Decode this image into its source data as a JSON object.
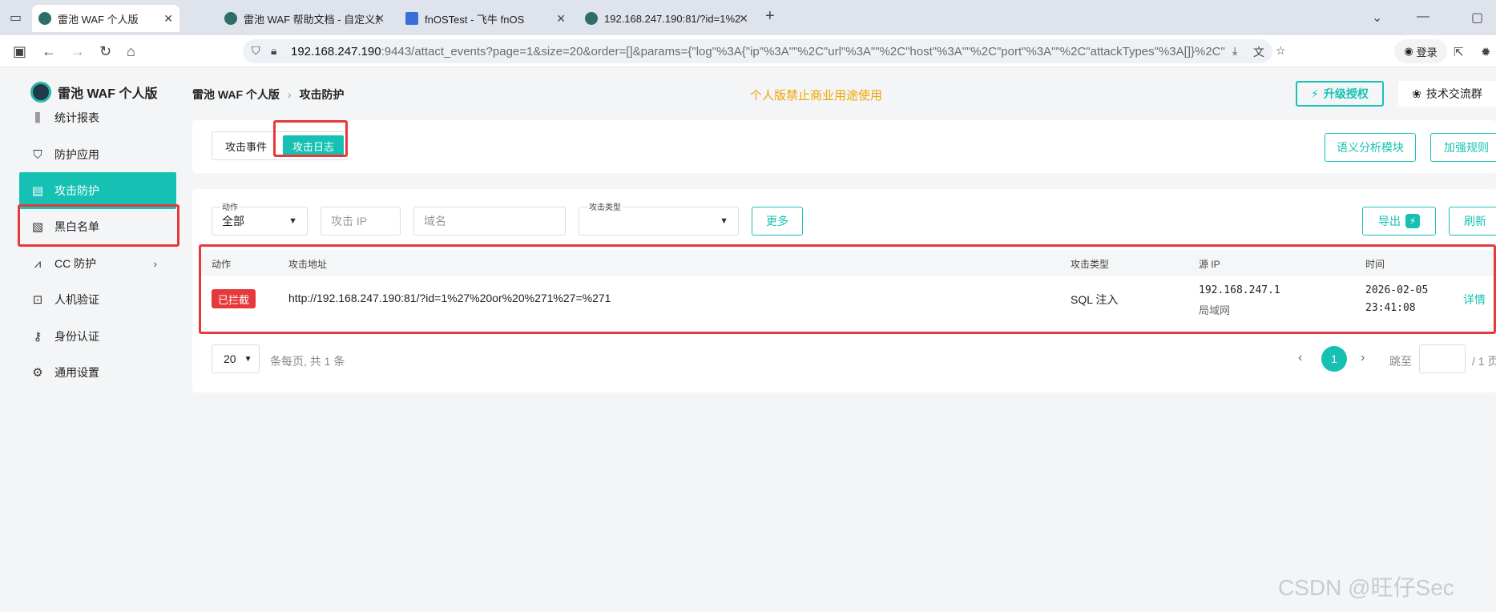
{
  "browser": {
    "tabs": [
      {
        "title": "雷池 WAF 个人版",
        "active": true
      },
      {
        "title": "雷池 WAF 帮助文档 - 自定义规",
        "active": false
      },
      {
        "title": "fnOSTest - 飞牛 fnOS",
        "active": false
      },
      {
        "title": "192.168.247.190:81/?id=1%2",
        "active": false
      }
    ],
    "url_host": "192.168.247.190",
    "url_rest": ":9443/attact_events?page=1&size=20&order=[]&params={\"log\"%3A{\"ip\"%3A\"\"%2C\"url\"%3A\"\"%2C\"host\"%3A\"\"%2C\"port\"%3A\"\"%2C\"attackTypes\"%3A[]}%2C\"",
    "login_label": "登录"
  },
  "app": {
    "name": "雷池 WAF 个人版",
    "breadcrumb": [
      "雷池 WAF 个人版",
      "攻击防护"
    ],
    "notice": "个人版禁止商业用途使用",
    "upgrade_label": "升级授权",
    "group_label": "技术交流群"
  },
  "sidebar": {
    "items": [
      {
        "label": "统计报表",
        "icon": "bar-chart-icon",
        "glyph": "⫼"
      },
      {
        "label": "防护应用",
        "icon": "shield-icon",
        "glyph": "⛉"
      },
      {
        "label": "攻击防护",
        "icon": "document-shield-icon",
        "glyph": "▤",
        "active": true
      },
      {
        "label": "黑白名单",
        "icon": "list-filter-icon",
        "glyph": "▧"
      },
      {
        "label": "CC 防护",
        "icon": "wave-icon",
        "glyph": "⩘",
        "has_children": true
      },
      {
        "label": "人机验证",
        "icon": "robot-icon",
        "glyph": "⊡"
      },
      {
        "label": "身份认证",
        "icon": "key-icon",
        "glyph": "⚷"
      },
      {
        "label": "通用设置",
        "icon": "gear-icon",
        "glyph": "⚙"
      }
    ]
  },
  "view_tabs": [
    "攻击事件",
    "攻击日志"
  ],
  "right_buttons": [
    "语义分析模块",
    "加强规则"
  ],
  "filters": {
    "action_label": "动作",
    "action_value": "全部",
    "ip_placeholder": "攻击 IP",
    "domain_placeholder": "域名",
    "attack_type_label": "攻击类型",
    "more_label": "更多",
    "export_label": "导出",
    "refresh_label": "刷新"
  },
  "table": {
    "columns": [
      "动作",
      "攻击地址",
      "攻击类型",
      "源 IP",
      "时间"
    ],
    "rows": [
      {
        "action": "已拦截",
        "url": "http://192.168.247.190:81/?id=1%27%20or%20%271%27=%271",
        "attack_type": "SQL 注入",
        "ip": "192.168.247.1",
        "ip_location": "局域网",
        "date": "2026-02-05",
        "time": "23:41:08",
        "detail": "详情"
      }
    ]
  },
  "pagination": {
    "page_size": "20",
    "summary": "条每页, 共 1 条",
    "current": "1",
    "jump_label": "跳至",
    "total_label": "/ 1 页"
  },
  "watermark": "CSDN @旺仔Sec",
  "colors": {
    "accent": "#16c1b3",
    "danger": "#e5393c",
    "notice": "#f0a500"
  }
}
